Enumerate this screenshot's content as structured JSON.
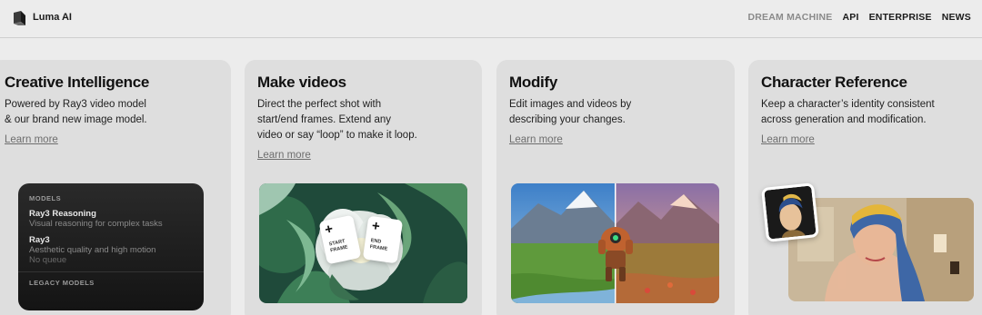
{
  "header": {
    "brand": "Luma AI",
    "nav": [
      "DREAM MACHINE",
      "API",
      "ENTERPRISE",
      "NEWS"
    ]
  },
  "cards": [
    {
      "title": "Creative Intelligence",
      "desc_lines": [
        "Powered by Ray3 video model",
        "& our brand new image model."
      ],
      "link": "Learn more",
      "models_panel": {
        "section1": "MODELS",
        "items": [
          {
            "name": "Ray3 Reasoning",
            "desc": "Visual reasoning for complex tasks"
          },
          {
            "name": "Ray3",
            "desc": "Aesthetic quality and high motion",
            "desc2": "No queue"
          }
        ],
        "section2": "LEGACY MODELS"
      }
    },
    {
      "title": "Make videos",
      "desc_lines": [
        "Direct the perfect shot with",
        "start/end frames. Extend any",
        "video or say “loop” to make it loop."
      ],
      "link": "Learn more",
      "frames": [
        {
          "plus": "+",
          "label1": "START",
          "label2": "FRAME"
        },
        {
          "plus": "+",
          "label1": "END",
          "label2": "FRAME"
        }
      ]
    },
    {
      "title": "Modify",
      "desc_lines": [
        "Edit images and videos by",
        "describing your changes."
      ],
      "link": "Learn more"
    },
    {
      "title": "Character Reference",
      "desc_lines": [
        "Keep a character’s identity consistent",
        "across generation and modification."
      ],
      "link": "Learn more"
    }
  ],
  "icons": {
    "logo": "luma-logo-icon",
    "plus": "plus-icon"
  }
}
